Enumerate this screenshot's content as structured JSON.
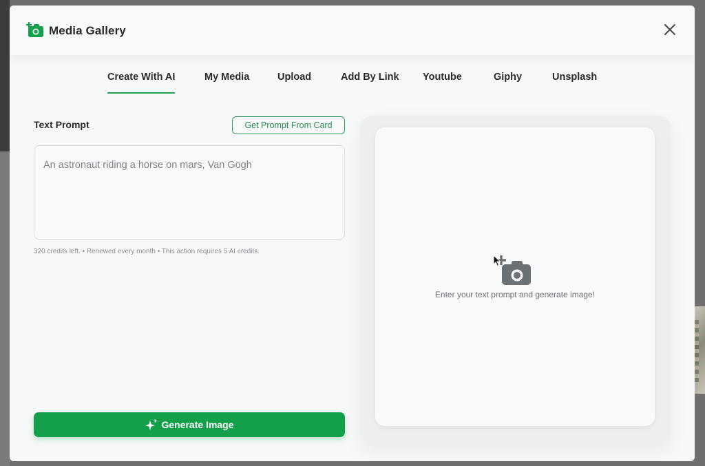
{
  "modal": {
    "title": "Media Gallery",
    "close_icon": "close-icon",
    "brand_icon": "camera-plus-icon"
  },
  "tabs": [
    {
      "label": "Create With AI",
      "active": true
    },
    {
      "label": "My Media",
      "active": false
    },
    {
      "label": "Upload",
      "active": false
    },
    {
      "label": "Add By Link",
      "active": false
    },
    {
      "label": "Youtube",
      "active": false
    },
    {
      "label": "Giphy",
      "active": false
    },
    {
      "label": "Unsplash",
      "active": false
    }
  ],
  "prompt": {
    "label": "Text Prompt",
    "get_prompt_button": "Get Prompt From Card",
    "placeholder": "An astronaut riding a horse on mars, Van Gogh",
    "value": "",
    "credits_note": "320 credits left. • Renewed every month • This action requires 5 AI credits."
  },
  "generate": {
    "label": "Generate Image",
    "icon": "sparkles-icon"
  },
  "preview": {
    "icon": "camera-plus-icon",
    "empty_text": "Enter your text prompt and generate image!"
  },
  "colors": {
    "accent": "#14a04a",
    "tab_underline": "#1ea152",
    "icon_gray": "#6b7075"
  }
}
